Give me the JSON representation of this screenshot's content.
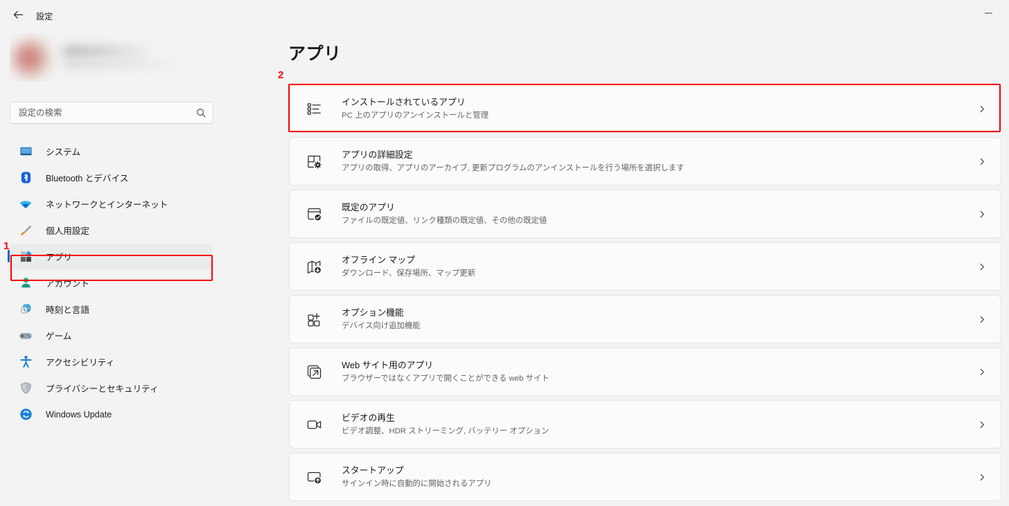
{
  "window": {
    "title": "設定",
    "back_icon": "back-arrow-icon",
    "minimize_icon": "minimize-icon"
  },
  "sidebar": {
    "account": {
      "blurred": "true",
      "note": "blurred user account name and email"
    },
    "search": {
      "placeholder": "設定の検索",
      "value": "",
      "icon": "search-icon"
    },
    "items": [
      {
        "label": "システム",
        "icon": "monitor-icon",
        "selected": "false"
      },
      {
        "label": "Bluetooth とデバイス",
        "icon": "bluetooth-icon",
        "selected": "false"
      },
      {
        "label": "ネットワークとインターネット",
        "icon": "wifi-icon",
        "selected": "false"
      },
      {
        "label": "個人用設定",
        "icon": "paintbrush-icon",
        "selected": "false"
      },
      {
        "label": "アプリ",
        "icon": "apps-icon",
        "selected": "true"
      },
      {
        "label": "アカウント",
        "icon": "person-icon",
        "selected": "false"
      },
      {
        "label": "時刻と言語",
        "icon": "clock-globe-icon",
        "selected": "false"
      },
      {
        "label": "ゲーム",
        "icon": "gamepad-icon",
        "selected": "false"
      },
      {
        "label": "アクセシビリティ",
        "icon": "accessibility-icon",
        "selected": "false"
      },
      {
        "label": "プライバシーとセキュリティ",
        "icon": "shield-icon",
        "selected": "false"
      },
      {
        "label": "Windows Update",
        "icon": "sync-icon",
        "selected": "false"
      }
    ]
  },
  "main": {
    "page_title": "アプリ",
    "cards": [
      {
        "title": "インストールされているアプリ",
        "subtitle": "PC 上のアプリのアンインストールと管理",
        "icon": "list-bullets-icon",
        "chevron": "chevron-right-icon"
      },
      {
        "title": "アプリの詳細設定",
        "subtitle": "アプリの取得、アプリのアーカイブ, 更新プログラムのアンインストールを行う場所を選択します",
        "icon": "apps-settings-icon",
        "chevron": "chevron-right-icon"
      },
      {
        "title": "既定のアプリ",
        "subtitle": "ファイルの既定値、リンク種類の既定値、その他の既定値",
        "icon": "window-check-icon",
        "chevron": "chevron-right-icon"
      },
      {
        "title": "オフライン マップ",
        "subtitle": "ダウンロード、保存場所、マップ更新",
        "icon": "map-download-icon",
        "chevron": "chevron-right-icon"
      },
      {
        "title": "オプション機能",
        "subtitle": "デバイス向け追加機能",
        "icon": "grid-plus-icon",
        "chevron": "chevron-right-icon"
      },
      {
        "title": "Web サイト用のアプリ",
        "subtitle": "ブラウザーではなくアプリで開くことができる web サイト",
        "icon": "external-link-icon",
        "chevron": "chevron-right-icon"
      },
      {
        "title": "ビデオの再生",
        "subtitle": "ビデオ調整、HDR ストリーミング, バッテリー オプション",
        "icon": "video-camera-icon",
        "chevron": "chevron-right-icon"
      },
      {
        "title": "スタートアップ",
        "subtitle": "サインイン時に自動的に開始されるアプリ",
        "icon": "startup-icon",
        "chevron": "chevron-right-icon"
      }
    ]
  },
  "annotations": [
    {
      "number": "1",
      "target": "sidebar-item-apps"
    },
    {
      "number": "2",
      "target": "installed-apps-card"
    }
  ],
  "colors": {
    "background": "#f3f3f3",
    "card": "#fbfbfb",
    "accent": "#0068c0",
    "annotation": "#ff0000",
    "text_primary": "#1a1a1a",
    "text_secondary": "#646464"
  }
}
